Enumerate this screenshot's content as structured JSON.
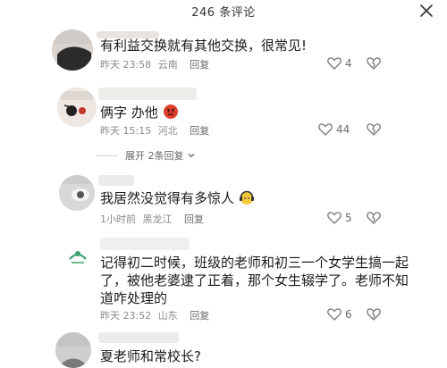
{
  "header": {
    "title": "246 条评论"
  },
  "comments": [
    {
      "text": "有利益交换就有其他交换，很常见!",
      "time": "昨天 23:58",
      "location": "云南",
      "reply": "回复",
      "likes": "4"
    },
    {
      "text": "俩字 办他",
      "time": "昨天 15:15",
      "location": "河北",
      "reply": "回复",
      "likes": "44"
    },
    {
      "text": "我居然没觉得有多惊人",
      "time": "1小时前",
      "location": "黑龙江",
      "reply": "回复",
      "likes": "5"
    },
    {
      "text_lines": [
        "记得初二时候，班级的老师和初三一个女学生搞一起",
        "了，被他老婆逮了正着，那个女生辍学了。老师不知",
        "道咋处理的"
      ],
      "time": "昨天 23:52",
      "location": "山东",
      "reply": "回复",
      "likes": "6"
    },
    {
      "text": "夏老师和常校长?"
    }
  ],
  "expand": {
    "label": "展开 2条回复"
  },
  "icons": {
    "close": "close-icon",
    "like": "heart-icon",
    "dislike": "broken-heart-icon",
    "chevron": "chevron-down-icon"
  }
}
